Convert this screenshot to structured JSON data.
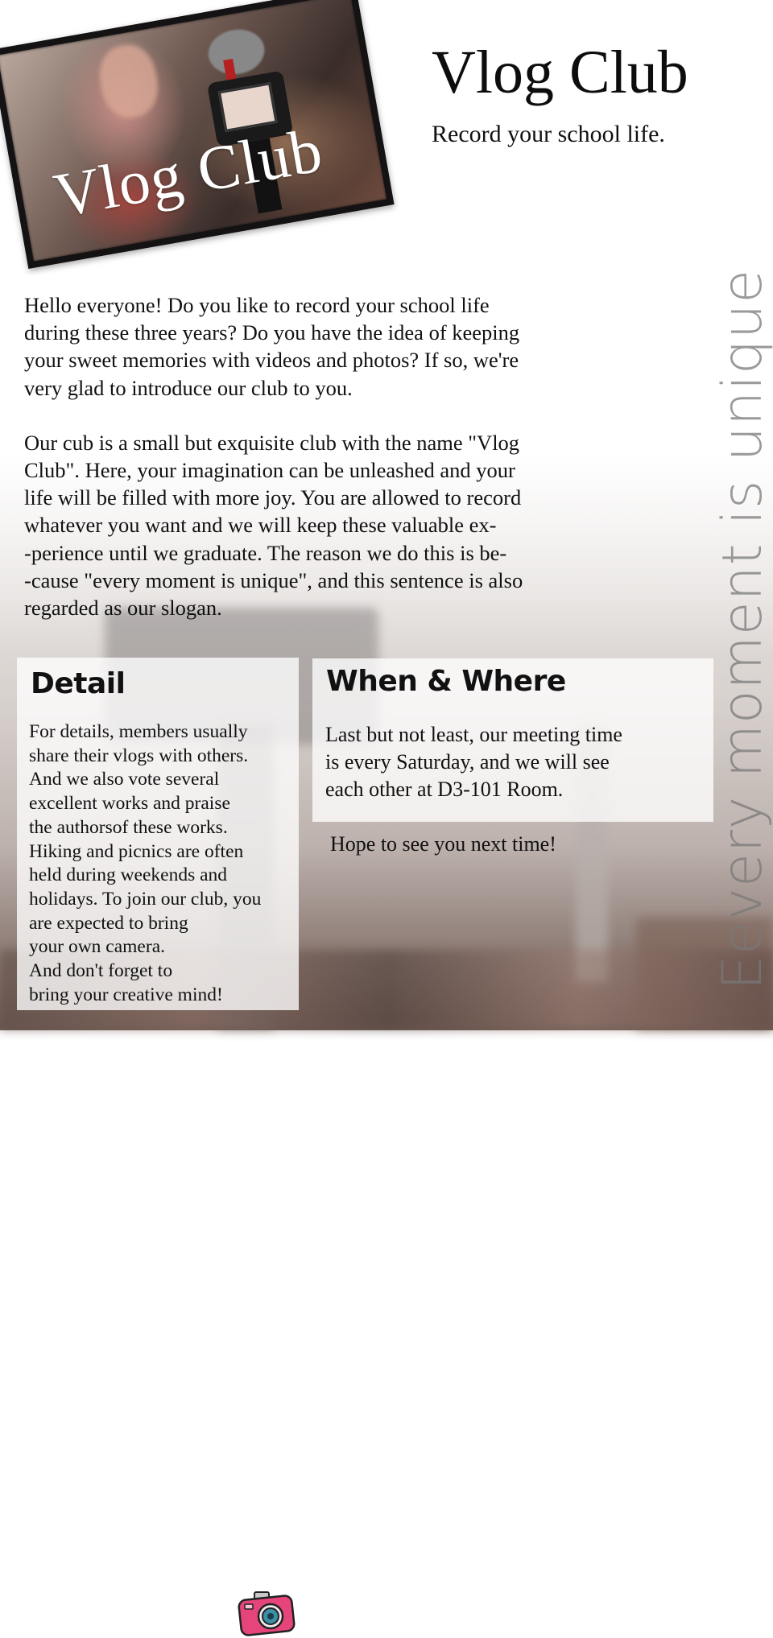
{
  "photo": {
    "overlay_text": "Vlog Club"
  },
  "header": {
    "title": "Vlog Club",
    "tagline": "Record your school life."
  },
  "intro": {
    "paragraph_1": "Hello everyone! Do you like to record your school life\nduring these three years? Do you have the idea of keeping\nyour sweet memories with videos and photos? If so, we're\nvery glad to introduce our club to you.",
    "paragraph_2": "Our cub is a small but exquisite club with the name \"Vlog\nClub\". Here, your imagination can be unleashed and your\nlife will be filled with more joy. You are allowed to record\nwhatever you want and we will keep these valuable ex-\n-perience until we graduate. The reason we do this is be-\n-cause \"every moment is unique\", and this sentence is also\nregarded as our slogan."
  },
  "slogan": "Eevery moment is unique",
  "detail": {
    "heading": "Detail",
    "body": "For details, members usually\n share their vlogs with others.\nAnd we also vote several\nexcellent works and praise\nthe authorsof these works.\nHiking and picnics are often\nheld during weekends and\nholidays. To join our club, you\nare expected to bring\nyour own camera.\nAnd don't forget to\nbring your creative mind!"
  },
  "when_where": {
    "heading": "When & Where",
    "body": "Last but not least, our meeting time\nis every Saturday, and we will see\neach other at D3-101 Room."
  },
  "closing": "Hope to see you next time!",
  "colors": {
    "camera_icon_body": "#e5457a",
    "camera_icon_lens": "#3b8fa6",
    "slogan_gray": "#787878"
  },
  "icons": {
    "camera": "camera-icon"
  }
}
